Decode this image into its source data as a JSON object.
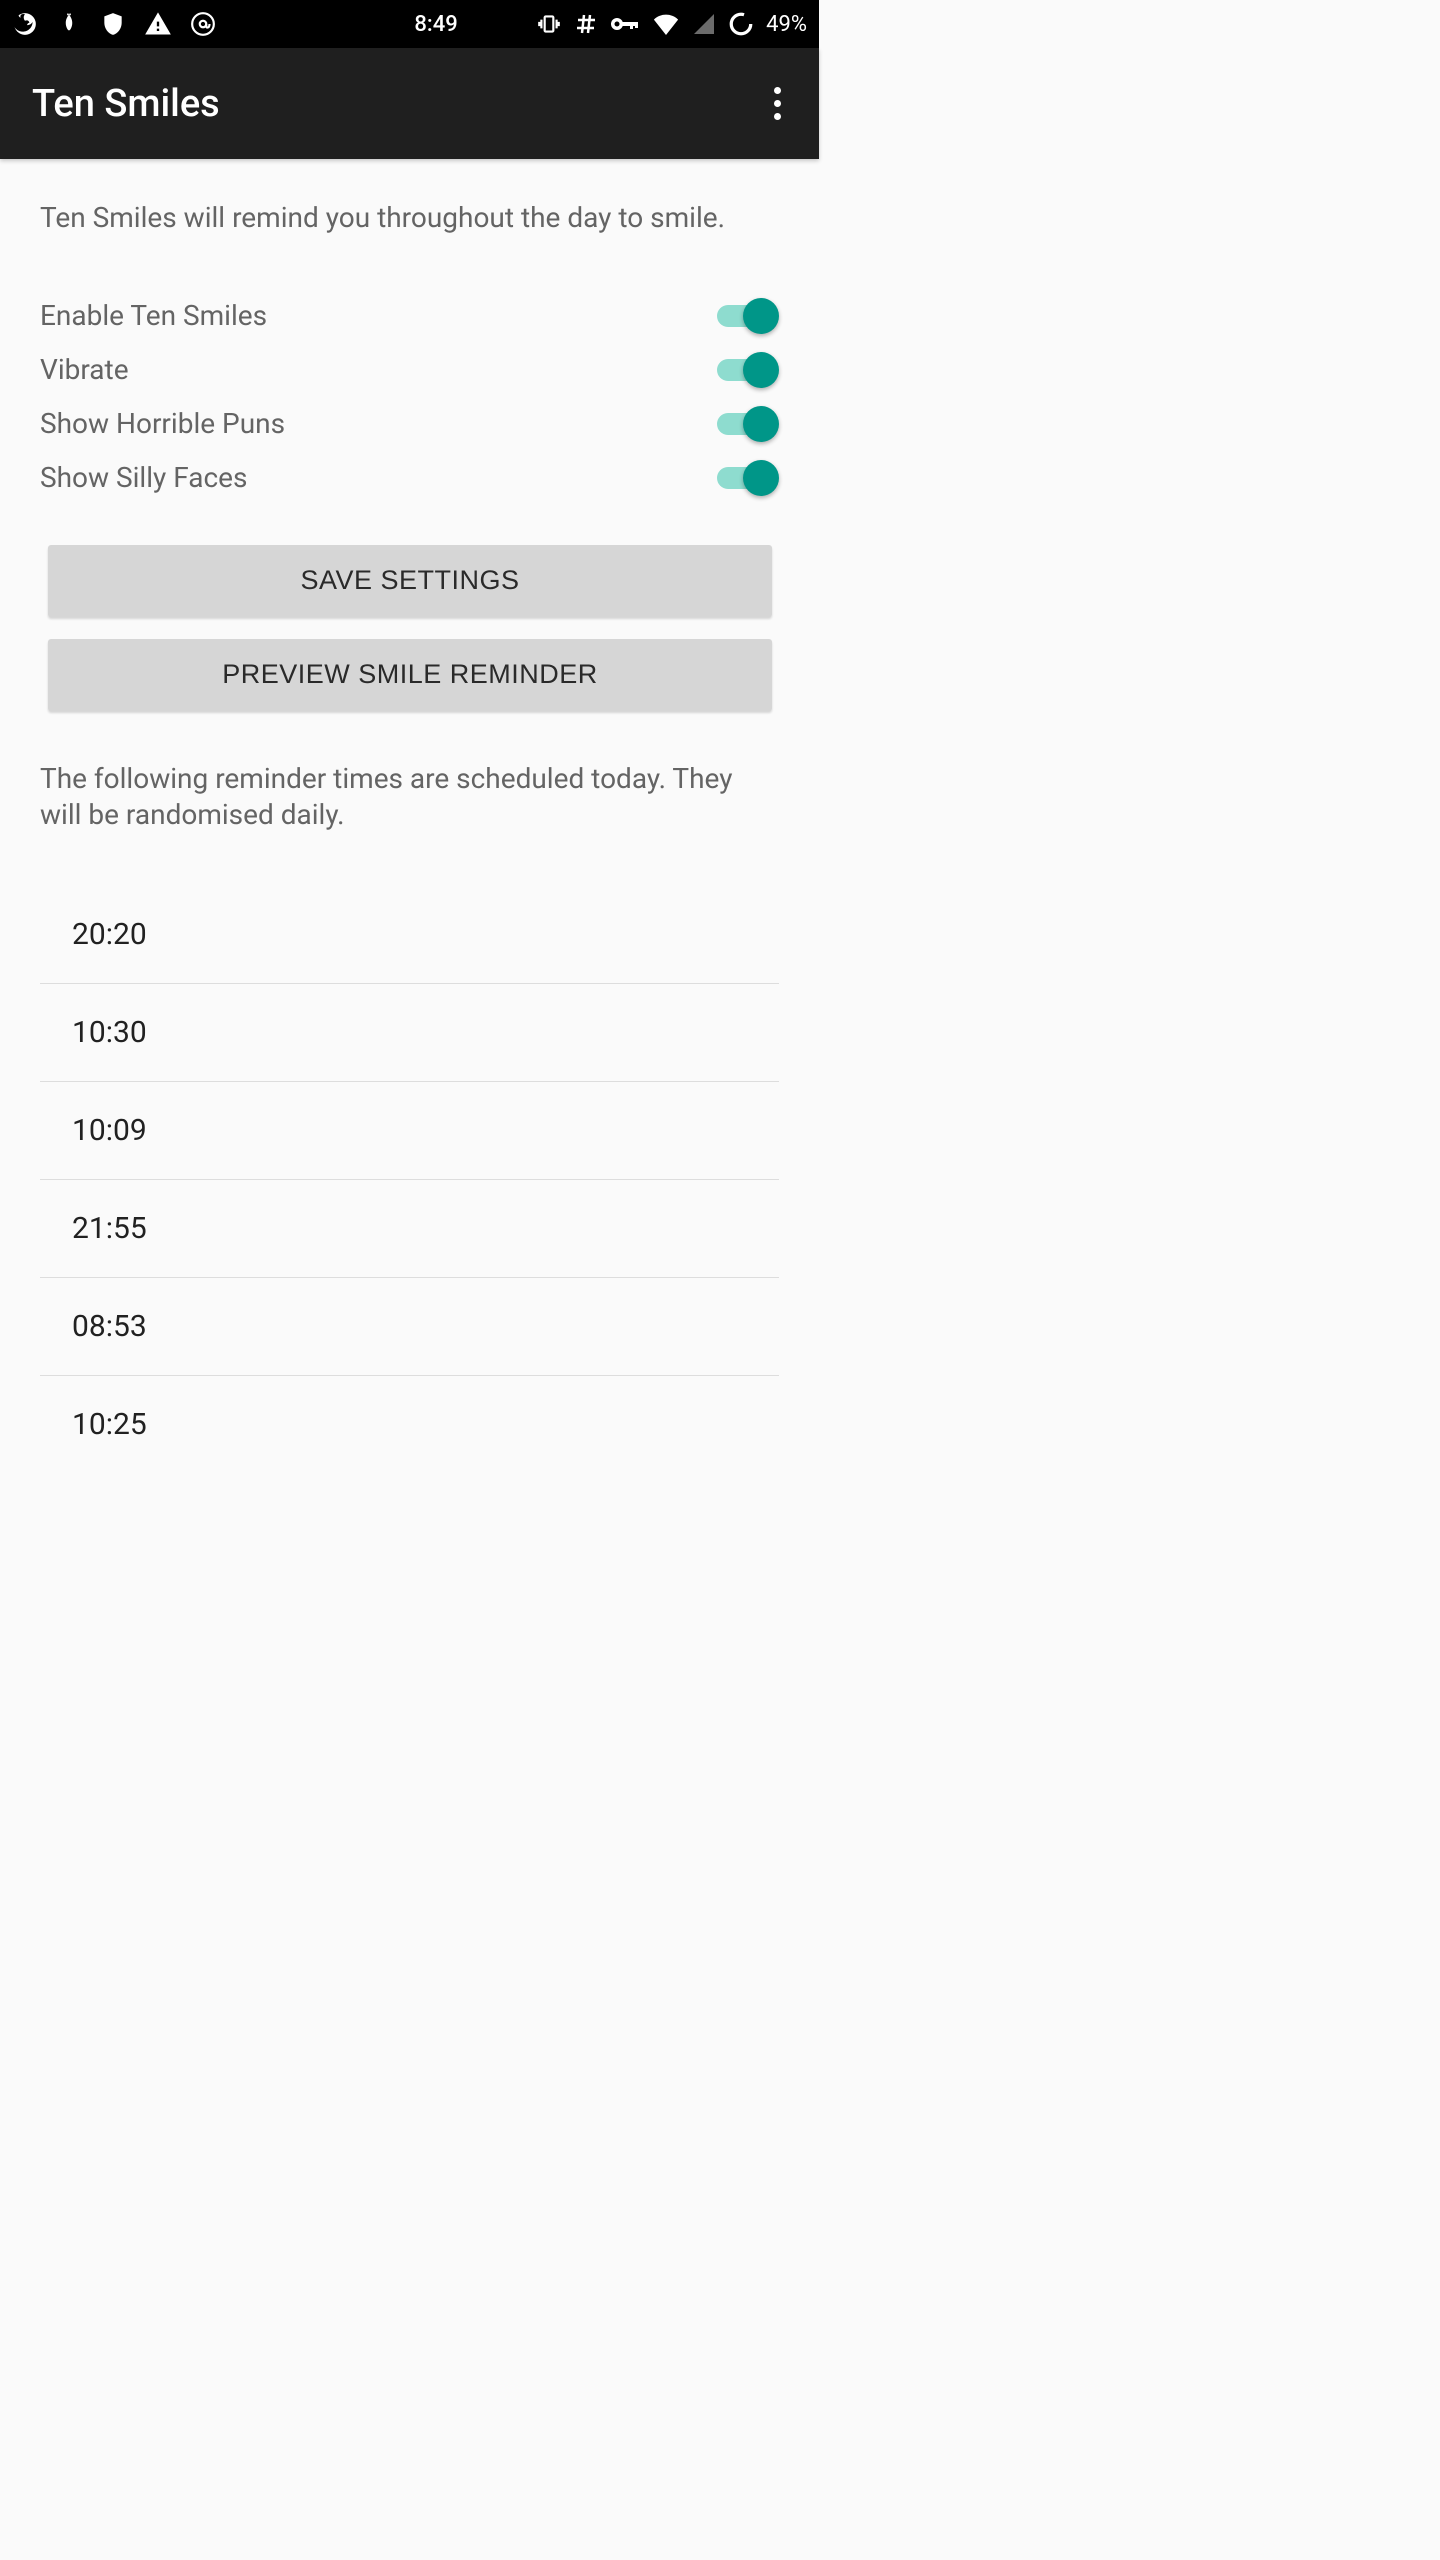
{
  "status": {
    "time": "8:49",
    "battery": "49%",
    "icons": {
      "firefox": "firefox-icon",
      "onion": "onion-icon",
      "shield": "shield-icon",
      "warning": "warning-icon",
      "at": "at-icon",
      "vibrate": "vibrate-icon",
      "hash": "hash-icon",
      "key": "key-icon",
      "wifi": "wifi-icon",
      "cell": "cell-icon",
      "circle": "circle-icon"
    }
  },
  "appbar": {
    "title": "Ten Smiles"
  },
  "content": {
    "intro": "Ten Smiles will remind you throughout the day to smile.",
    "settings": [
      {
        "label": "Enable Ten Smiles",
        "on": true
      },
      {
        "label": "Vibrate",
        "on": true
      },
      {
        "label": "Show Horrible Puns",
        "on": true
      },
      {
        "label": "Show Silly Faces",
        "on": true
      }
    ],
    "save_label": "SAVE SETTINGS",
    "preview_label": "PREVIEW SMILE REMINDER",
    "schedule_note": "The following reminder times are scheduled today. They will be randomised daily.",
    "times": [
      "20:20",
      "10:30",
      "10:09",
      "21:55",
      "08:53",
      "10:25"
    ]
  },
  "colors": {
    "accent": "#009688",
    "accent_light": "#8edccf"
  }
}
